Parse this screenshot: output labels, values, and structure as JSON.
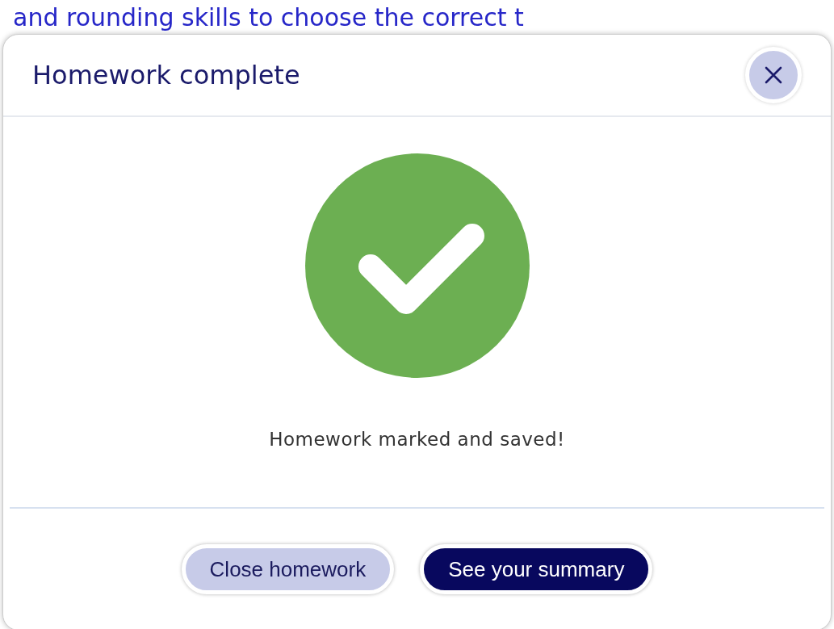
{
  "background_text": "and rounding skills to choose the correct t",
  "dialog": {
    "title": "Homework complete",
    "message": "Homework marked and saved!",
    "buttons": [
      {
        "label": "Close homework",
        "kind": "secondary"
      },
      {
        "label": "See your summary",
        "kind": "primary"
      }
    ]
  }
}
